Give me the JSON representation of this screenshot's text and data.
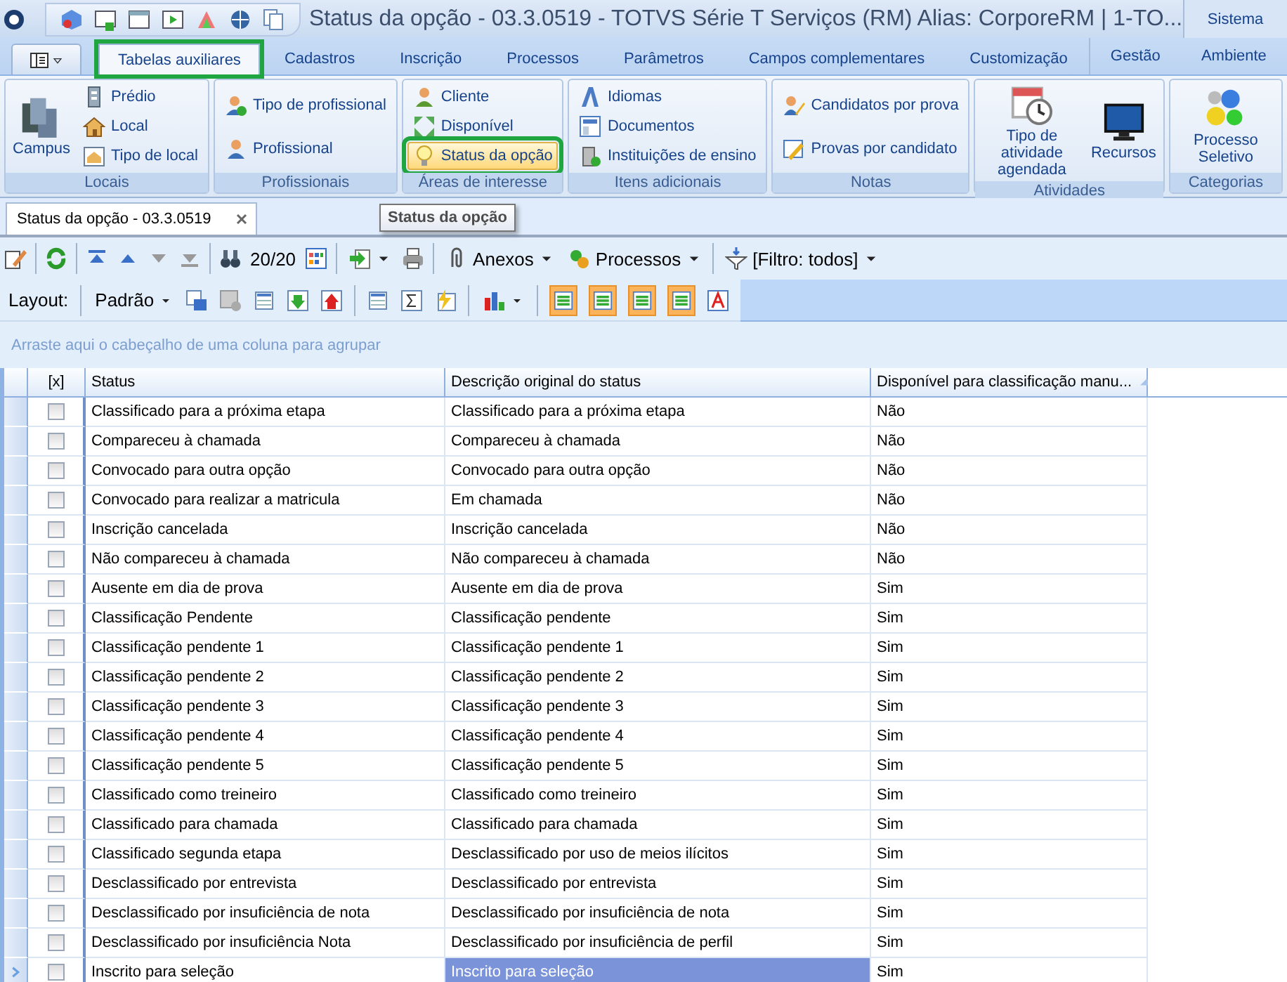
{
  "window": {
    "title": "Status da opção - 03.3.0519 - TOTVS Série T Serviços (RM) Alias: CorporeRM | 1-TO...",
    "system_label": "Sistema"
  },
  "ribbon_tabs": [
    {
      "label": "Tabelas auxiliares",
      "selected": true,
      "highlighted": true
    },
    {
      "label": "Cadastros",
      "selected": false,
      "highlighted": false
    },
    {
      "label": "Inscrição",
      "selected": false,
      "highlighted": false
    },
    {
      "label": "Processos",
      "selected": false,
      "highlighted": false
    },
    {
      "label": "Parâmetros",
      "selected": false,
      "highlighted": false
    },
    {
      "label": "Campos complementares",
      "selected": false,
      "highlighted": false
    },
    {
      "label": "Customização",
      "selected": false,
      "highlighted": false
    }
  ],
  "system_tabs": [
    {
      "label": "Gestão"
    },
    {
      "label": "Ambiente"
    }
  ],
  "ribbon_groups": [
    {
      "label": "Locais",
      "items": [
        {
          "label": "Campus",
          "kind": "large"
        },
        {
          "label": "Prédio",
          "kind": "small"
        },
        {
          "label": "Local",
          "kind": "small"
        },
        {
          "label": "Tipo de local",
          "kind": "small"
        }
      ]
    },
    {
      "label": "Profissionais",
      "items": [
        {
          "label": "Tipo de profissional",
          "kind": "small"
        },
        {
          "label": "Profissional",
          "kind": "small"
        }
      ]
    },
    {
      "label": "Áreas de interesse",
      "items": [
        {
          "label": "Cliente",
          "kind": "small"
        },
        {
          "label": "Disponível",
          "kind": "small"
        },
        {
          "label": "Status da opção",
          "kind": "small",
          "hovered": true,
          "highlighted": true
        }
      ]
    },
    {
      "label": "Itens adicionais",
      "items": [
        {
          "label": "Idiomas",
          "kind": "small"
        },
        {
          "label": "Documentos",
          "kind": "small"
        },
        {
          "label": "Instituições de ensino",
          "kind": "small"
        }
      ]
    },
    {
      "label": "Notas",
      "items": [
        {
          "label": "Candidatos por prova",
          "kind": "small"
        },
        {
          "label": "Provas por candidato",
          "kind": "small"
        }
      ]
    },
    {
      "label": "Atividades",
      "items": [
        {
          "label": "Tipo de atividade agendada",
          "kind": "large"
        },
        {
          "label": "Recursos",
          "kind": "large"
        }
      ]
    },
    {
      "label": "Categorias",
      "items": [
        {
          "label": "Processo Seletivo",
          "kind": "large"
        }
      ]
    }
  ],
  "document_tab": {
    "label": "Status da opção - 03.3.0519"
  },
  "tooltip": "Status da opção",
  "toolbar": {
    "record_counter": "20/20",
    "attachments": "Anexos",
    "processes": "Processos",
    "filter": "[Filtro: todos]"
  },
  "layout_bar": {
    "label": "Layout:",
    "layout": "Padrão"
  },
  "group_panel": {
    "placeholder": "Arraste aqui o cabeçalho de uma coluna para agrupar"
  },
  "table": {
    "columns": [
      {
        "label": "[x]"
      },
      {
        "label": "Status"
      },
      {
        "label": "Descrição original do status"
      },
      {
        "label": "Disponível para classificação manu...",
        "sorted": true
      }
    ],
    "rows": [
      {
        "checked": false,
        "selected": false,
        "status": "Classificado para a próxima etapa",
        "description": "Classificado para a próxima etapa",
        "available": "Não"
      },
      {
        "checked": false,
        "selected": false,
        "status": "Compareceu à chamada",
        "description": "Compareceu à chamada",
        "available": "Não"
      },
      {
        "checked": false,
        "selected": false,
        "status": "Convocado para outra opção",
        "description": "Convocado para outra opção",
        "available": "Não"
      },
      {
        "checked": false,
        "selected": false,
        "status": "Convocado para realizar a matricula",
        "description": "Em chamada",
        "available": "Não"
      },
      {
        "checked": false,
        "selected": false,
        "status": "Inscrição cancelada",
        "description": "Inscrição cancelada",
        "available": "Não"
      },
      {
        "checked": false,
        "selected": false,
        "status": "Não compareceu à chamada",
        "description": "Não compareceu à chamada",
        "available": "Não"
      },
      {
        "checked": false,
        "selected": false,
        "status": "Ausente em dia de prova",
        "description": "Ausente em dia de prova",
        "available": "Sim"
      },
      {
        "checked": false,
        "selected": false,
        "status": "Classificação Pendente",
        "description": "Classificação pendente",
        "available": "Sim"
      },
      {
        "checked": false,
        "selected": false,
        "status": "Classificação pendente 1",
        "description": "Classificação pendente 1",
        "available": "Sim"
      },
      {
        "checked": false,
        "selected": false,
        "status": "Classificação pendente 2",
        "description": "Classificação pendente 2",
        "available": "Sim"
      },
      {
        "checked": false,
        "selected": false,
        "status": "Classificação pendente 3",
        "description": "Classificação pendente 3",
        "available": "Sim"
      },
      {
        "checked": false,
        "selected": false,
        "status": "Classificação pendente 4",
        "description": "Classificação pendente 4",
        "available": "Sim"
      },
      {
        "checked": false,
        "selected": false,
        "status": "Classificação pendente 5",
        "description": "Classificação pendente 5",
        "available": "Sim"
      },
      {
        "checked": false,
        "selected": false,
        "status": "Classificado como treineiro",
        "description": "Classificado como treineiro",
        "available": "Sim"
      },
      {
        "checked": false,
        "selected": false,
        "status": "Classificado para chamada",
        "description": "Classificado para chamada",
        "available": "Sim"
      },
      {
        "checked": false,
        "selected": false,
        "status": "Classificado segunda etapa",
        "description": "Desclassificado por uso de meios ilícitos",
        "available": "Sim"
      },
      {
        "checked": false,
        "selected": false,
        "status": "Desclassificado por entrevista",
        "description": "Desclassificado por entrevista",
        "available": "Sim"
      },
      {
        "checked": false,
        "selected": false,
        "status": "Desclassificado por insuficiência de nota",
        "description": "Desclassificado por insuficiência de nota",
        "available": "Sim"
      },
      {
        "checked": false,
        "selected": false,
        "status": "Desclassificado por insuficiência Nota",
        "description": "Desclassificado por insuficiência de perfil",
        "available": "Sim"
      },
      {
        "checked": false,
        "selected": true,
        "status": "Inscrito para seleção",
        "description": "Inscrito para seleção",
        "available": "Sim"
      }
    ]
  }
}
